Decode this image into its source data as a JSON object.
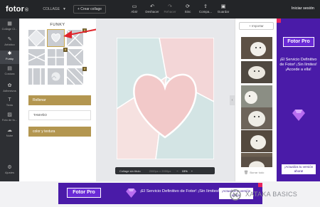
{
  "topbar": {
    "logo": "fotor",
    "logo_suffix": "®",
    "mode": "COLLAGE",
    "create_btn": "+ Crear collage",
    "tools": [
      {
        "label": "Abrir",
        "icon": "open-icon"
      },
      {
        "label": "Deshacer",
        "icon": "undo-icon"
      },
      {
        "label": "Rehacer",
        "icon": "redo-icon"
      },
      {
        "label": "Sinc",
        "icon": "sync-icon"
      },
      {
        "label": "Compa...",
        "icon": "share-icon"
      },
      {
        "label": "Guardar",
        "icon": "save-icon"
      }
    ],
    "login": "Iniciar sesión"
  },
  "sidebar": {
    "items": [
      {
        "label": "Collage Cl...",
        "icon": "grid-icon"
      },
      {
        "label": "Artístico",
        "icon": "brush-icon"
      },
      {
        "label": "Funky",
        "icon": "funky-icon"
      },
      {
        "label": "Costura",
        "icon": "stitch-icon"
      },
      {
        "label": "Adhesivos",
        "icon": "sticker-icon"
      },
      {
        "label": "Texto",
        "icon": "text-icon"
      },
      {
        "label": "Foto de fo...",
        "icon": "photo-bg-icon"
      },
      {
        "label": "Nube",
        "icon": "cloud-icon"
      },
      {
        "label": "Ajustes",
        "icon": "settings-icon"
      }
    ]
  },
  "panel": {
    "title": "FUNKY",
    "fill_btn": "Rellenar",
    "size_label": "TAMAÑO",
    "color_btn": "color y textura"
  },
  "canvas": {
    "name": "Collage sin título",
    "dimensions": "2000px × 2000px",
    "zoom_minus": "−",
    "zoom": "15%",
    "zoom_plus": "+",
    "colors": {
      "teal": "#cfe3e3",
      "pink": "#f3d6d7",
      "heart": "#f2c9c9",
      "light_pink": "#f7e4e2"
    }
  },
  "photos": {
    "import": "+ Importar",
    "clear_all": "Borrar todo"
  },
  "right_ad": {
    "brand": "Fotor Pro",
    "text": "¡El Servicio Definitivo de Fotor! ¡Sin límites! ¡Accede a ella!",
    "cta": "¡Actualiza tu versión ahora!"
  },
  "bottom_ad": {
    "brand": "Fotor Pro",
    "text": "¡El Servicio Definitivo de Fotor! ¡Sin límites! ¡Accede a ella!",
    "cta": "¡Actualiza tu versión ahora!"
  },
  "watermark": "XATAKA BASICS"
}
